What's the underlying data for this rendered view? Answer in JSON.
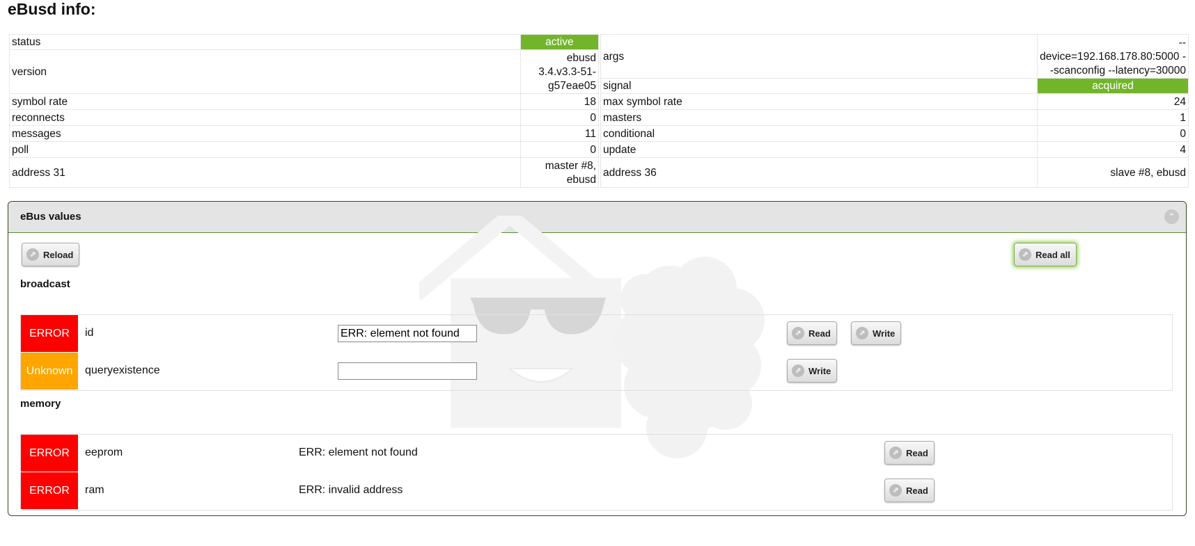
{
  "page": {
    "title": "eBusd info:"
  },
  "info": {
    "left": [
      {
        "label": "status",
        "value": "active",
        "highlight": true
      },
      {
        "label": "version",
        "value": "ebusd 3.4.v3.3-51-g57eae05"
      },
      {
        "label": "symbol rate",
        "value": "18"
      },
      {
        "label": "reconnects",
        "value": "0"
      },
      {
        "label": "messages",
        "value": "11"
      },
      {
        "label": "poll",
        "value": "0"
      },
      {
        "label": "address 31",
        "value": "master #8, ebusd"
      }
    ],
    "right": [
      {
        "label": "args",
        "value": "--device=192.168.178.80:5000 --scanconfig --latency=30000"
      },
      {
        "label": "signal",
        "value": "acquired",
        "highlight": true
      },
      {
        "label": "max symbol rate",
        "value": "24"
      },
      {
        "label": "masters",
        "value": "1"
      },
      {
        "label": "conditional",
        "value": "0"
      },
      {
        "label": "update",
        "value": "4"
      },
      {
        "label": "address 36",
        "value": "slave #8, ebusd"
      }
    ],
    "highlight_color": "#72b52a"
  },
  "panel": {
    "title": "eBus values",
    "reload_label": "Reload",
    "read_all_label": "Read all",
    "sections": [
      {
        "title": "broadcast",
        "rows": [
          {
            "status": "ERROR",
            "name": "id",
            "input_value": "ERR: element not found",
            "buttons": [
              "Read",
              "Write"
            ]
          },
          {
            "status": "Unknown",
            "name": "queryexistence",
            "input_value": "",
            "buttons": [
              "Write"
            ]
          }
        ]
      },
      {
        "title": "memory",
        "rows": [
          {
            "status": "ERROR",
            "name": "eeprom",
            "value": "ERR: element not found",
            "buttons": [
              "Read"
            ]
          },
          {
            "status": "ERROR",
            "name": "ram",
            "value": "ERR: invalid address",
            "buttons": [
              "Read"
            ]
          }
        ]
      }
    ]
  },
  "colors": {
    "error": "#ff0000",
    "unknown": "#ffa500",
    "accent": "#72b52a"
  }
}
